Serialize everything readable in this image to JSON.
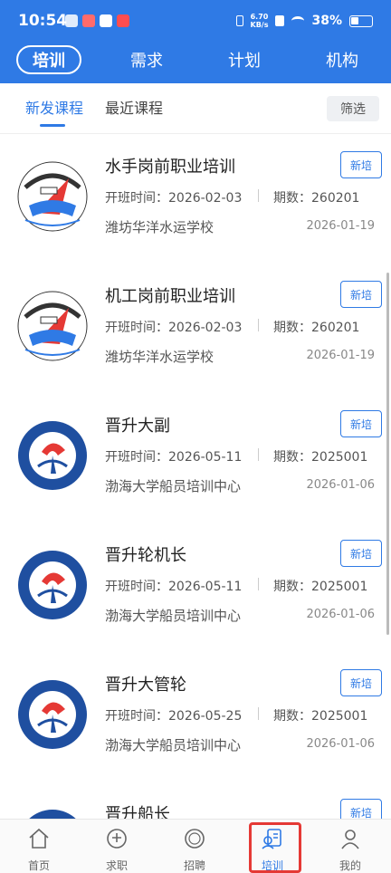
{
  "status_bar": {
    "time": "10:54",
    "net_speed_value": "6.70",
    "net_speed_unit": "KB/s",
    "battery": "38%"
  },
  "nav_tabs": [
    {
      "label": "培训",
      "active": true
    },
    {
      "label": "需求",
      "active": false
    },
    {
      "label": "计划",
      "active": false
    },
    {
      "label": "机构",
      "active": false
    }
  ],
  "sub_tabs": [
    {
      "label": "新发课程",
      "active": true
    },
    {
      "label": "最近课程",
      "active": false
    }
  ],
  "filter_label": "筛选",
  "labels": {
    "start_time": "开班时间：",
    "period": "期数："
  },
  "courses": [
    {
      "title": "水手岗前职业培训",
      "tag": "新培",
      "start": "2026-02-03",
      "period": "260201",
      "org": "潍坊华洋水运学校",
      "date": "2026-01-19",
      "logo": "huayang"
    },
    {
      "title": "机工岗前职业培训",
      "tag": "新培",
      "start": "2026-02-03",
      "period": "260201",
      "org": "潍坊华洋水运学校",
      "date": "2026-01-19",
      "logo": "huayang"
    },
    {
      "title": "晋升大副",
      "tag": "新培",
      "start": "2026-05-11",
      "period": "2025001",
      "org": "渤海大学船员培训中心",
      "date": "2026-01-06",
      "logo": "bohai"
    },
    {
      "title": "晋升轮机长",
      "tag": "新培",
      "start": "2026-05-11",
      "period": "2025001",
      "org": "渤海大学船员培训中心",
      "date": "2026-01-06",
      "logo": "bohai"
    },
    {
      "title": "晋升大管轮",
      "tag": "新培",
      "start": "2026-05-25",
      "period": "2025001",
      "org": "渤海大学船员培训中心",
      "date": "2026-01-06",
      "logo": "bohai"
    },
    {
      "title": "晋升船长",
      "tag": "新培",
      "start": "",
      "period": "",
      "org": "",
      "date": "",
      "logo": "bohai"
    }
  ],
  "bottom_nav": [
    {
      "label": "首页",
      "icon": "home-icon"
    },
    {
      "label": "求职",
      "icon": "job-seek-icon"
    },
    {
      "label": "招聘",
      "icon": "recruit-icon"
    },
    {
      "label": "培训",
      "icon": "training-icon",
      "active": true
    },
    {
      "label": "我的",
      "icon": "profile-icon"
    }
  ],
  "colors": {
    "primary": "#2f7ae5",
    "highlight": "#e53935"
  }
}
